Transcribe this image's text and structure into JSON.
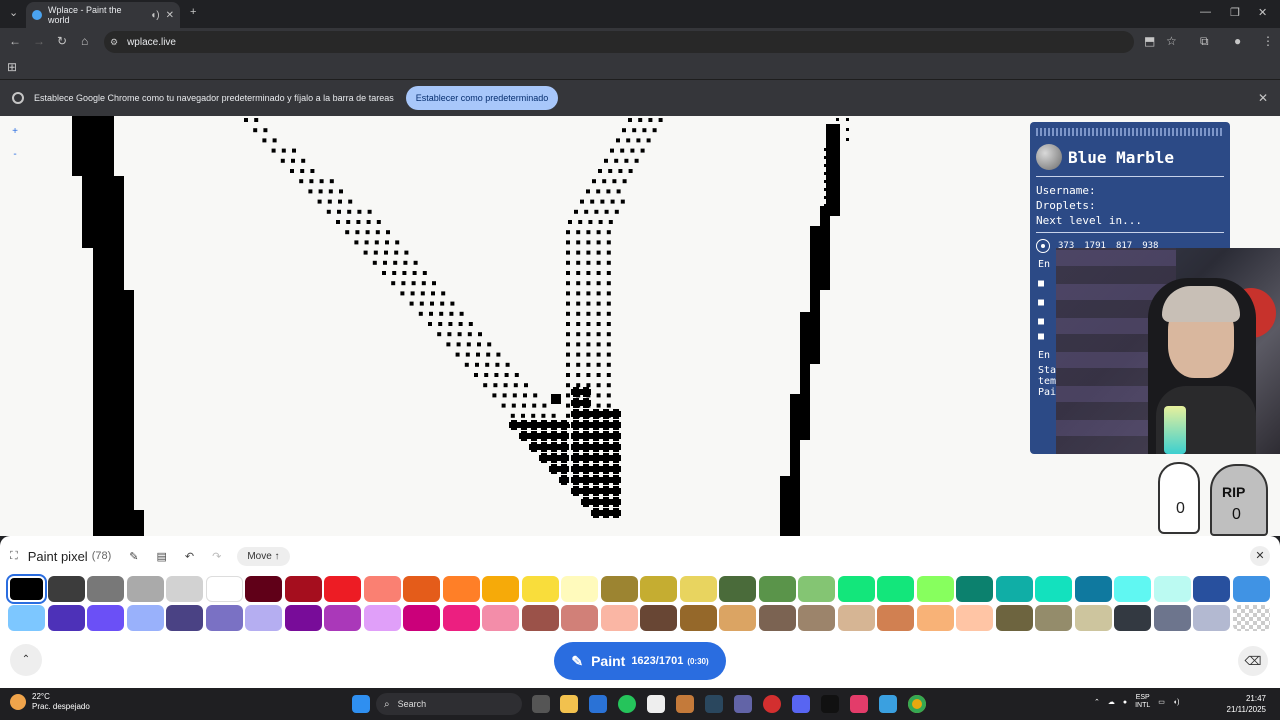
{
  "browser": {
    "tab_title": "Wplace - Paint the world",
    "url": "wplace.live",
    "infobar_text": "Establece Google Chrome como tu navegador predeterminado y fíjalo a la barra de tareas",
    "infobar_button": "Establecer como predeterminado"
  },
  "canvas": {
    "zoom_in": "+",
    "zoom_out": "-"
  },
  "blue_marble": {
    "title": "Blue Marble",
    "username_label": "Username:",
    "droplets_label": "Droplets:",
    "next_level_label": "Next level in...",
    "coords": [
      "373",
      "1791",
      "817",
      "938"
    ],
    "partial_lines": [
      "En",
      "En",
      "Sta",
      "tem",
      "Pai"
    ]
  },
  "decorations": {
    "ghost_count": "0",
    "rip_label": "RIP",
    "rip_count": "0"
  },
  "paint_panel": {
    "title": "Paint pixel",
    "count": "(78)",
    "move_label": "Move ↑",
    "paint_label": "Paint",
    "paint_count": "1623/1701",
    "paint_timer": "(0:30)",
    "colors": [
      "#000000",
      "#3c3c3c",
      "#787878",
      "#aaaaaa",
      "#d2d2d2",
      "#ffffff",
      "#600018",
      "#a50e1e",
      "#ed1c24",
      "#fa8072",
      "#e45c1a",
      "#ff7f27",
      "#f6aa09",
      "#f9dd3b",
      "#fffabc",
      "#9c8431",
      "#c5ad31",
      "#e8d45f",
      "#4a6b3a",
      "#5a944a",
      "#84c573",
      "#13e67b",
      "#13e67b",
      "#87ff5e",
      "#0c816e",
      "#10aea6",
      "#13e1be",
      "#0f799f",
      "#60f7f2",
      "#bbfaf2",
      "#28509e",
      "#4093e4",
      "#7dc7ff",
      "#4d31b8",
      "#6b50f6",
      "#99b1fb",
      "#4a4284",
      "#7a71c4",
      "#b5aef1",
      "#780c99",
      "#aa38b9",
      "#e09ff9",
      "#cb007a",
      "#ec1f80",
      "#f38da9",
      "#9b5249",
      "#d18078",
      "#fab6a4",
      "#684634",
      "#95682a",
      "#dba463",
      "#7b6352",
      "#9c846b",
      "#d6b594",
      "#d18051",
      "#f8b277",
      "#ffc5a5",
      "#6d643f",
      "#948c6b",
      "#cdc59e",
      "#333941",
      "#6d758d",
      "#b3b9d1",
      "transparent"
    ],
    "selected_color": "#000000"
  },
  "taskbar": {
    "temp": "22°C",
    "weather": "Prac. despejado",
    "search": "Search",
    "lang_top": "ESP",
    "lang_bottom": "INTL",
    "time": "21:47",
    "date": "21/11/2025"
  }
}
